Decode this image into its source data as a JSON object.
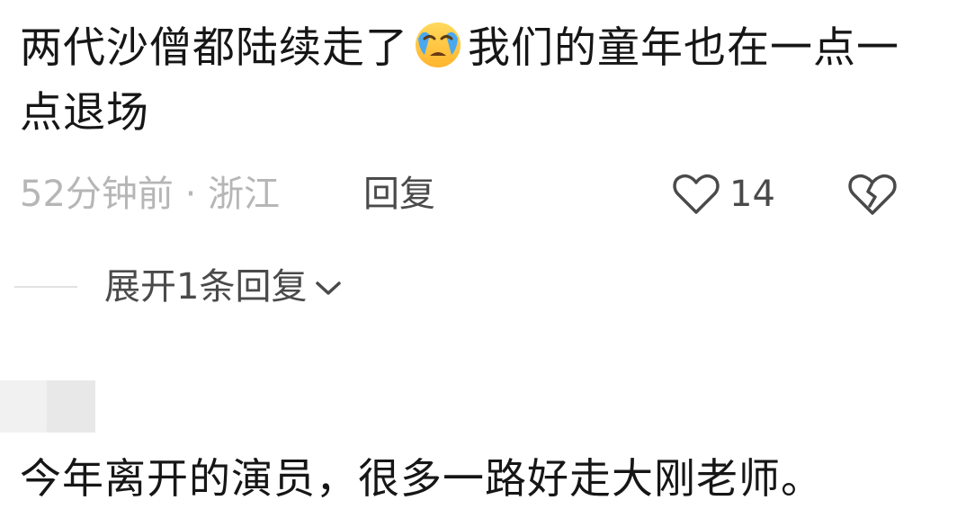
{
  "comment1": {
    "text_part1": "两代沙僧都陆续走了",
    "emoji": "crying-face-icon",
    "text_part2": "我们的童年也在一点一点退场",
    "time": "52分钟前",
    "separator": " · ",
    "location": "浙江",
    "reply_label": "回复",
    "like_count": "14",
    "expand_label": "展开1条回复"
  },
  "comment2": {
    "text": "今年离开的演员，很多一路好走大刚老师。"
  },
  "colors": {
    "text_primary": "#161616",
    "text_secondary": "#4a4a4a",
    "text_muted": "#b6b6b6",
    "emoji_face": "#ffc93c",
    "emoji_tear": "#4aa8f0"
  }
}
